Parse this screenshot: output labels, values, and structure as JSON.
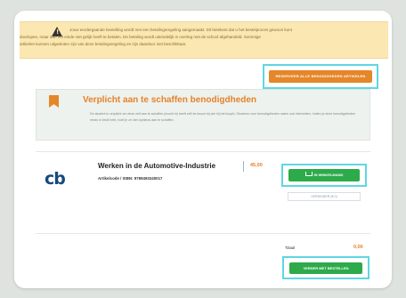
{
  "warning": {
    "icon": "warning-triangle-icon",
    "line1": "Jouw eerdergaande bestelling wordt met een betalingsregeling aangemaakt. Dit betekent dat u het bestelproces gewoon kunt",
    "line2": "doorlopen, maar aan het einde niet gelijk hoeft te betalen. De betaling wordt uiteindelijk in overleg met de school afgehandeld. Sommige",
    "line3": "artikelen kunnen uitgesloten zijn van deze betalingsregeling en zijn daardoor niet beschikbaar."
  },
  "actions": {
    "reserve_all": "RESERVEER ALLE BENODIGHEDEN ARTIKELEN"
  },
  "required_section": {
    "icon": "bookmark-icon",
    "title": "Verplicht aan te schaffen benodigdheden",
    "description": "De student is verplicht om deze zelf aan te schaffen (mocht hij heeft zelf de keuze bij wie hij het koopt). Studeren voor benodigdheden raden ook internetten. Indien je deze benodigdheden reeds in bezit hebt, hoef je ze niet opnieuw aan te schaffen."
  },
  "product": {
    "logo": "cb",
    "title": "Werken in de Automotive-Industrie",
    "meta": "Artikelcode / ISBN: 9789493240017",
    "price": "45,00",
    "add_to_cart": "IN WINKELMAND",
    "cart_icon": "cart-icon",
    "remove": "VERWIJDER (€ 0)"
  },
  "summary": {
    "total_label": "Totaal",
    "total_value": "0,00",
    "order_button": "VERDER MET BESTELLEN"
  },
  "colors": {
    "accent_orange": "#e58628",
    "primary_green": "#2daa4a",
    "warning_bg": "#fbe7b2",
    "highlight": "#5fd6e3"
  }
}
